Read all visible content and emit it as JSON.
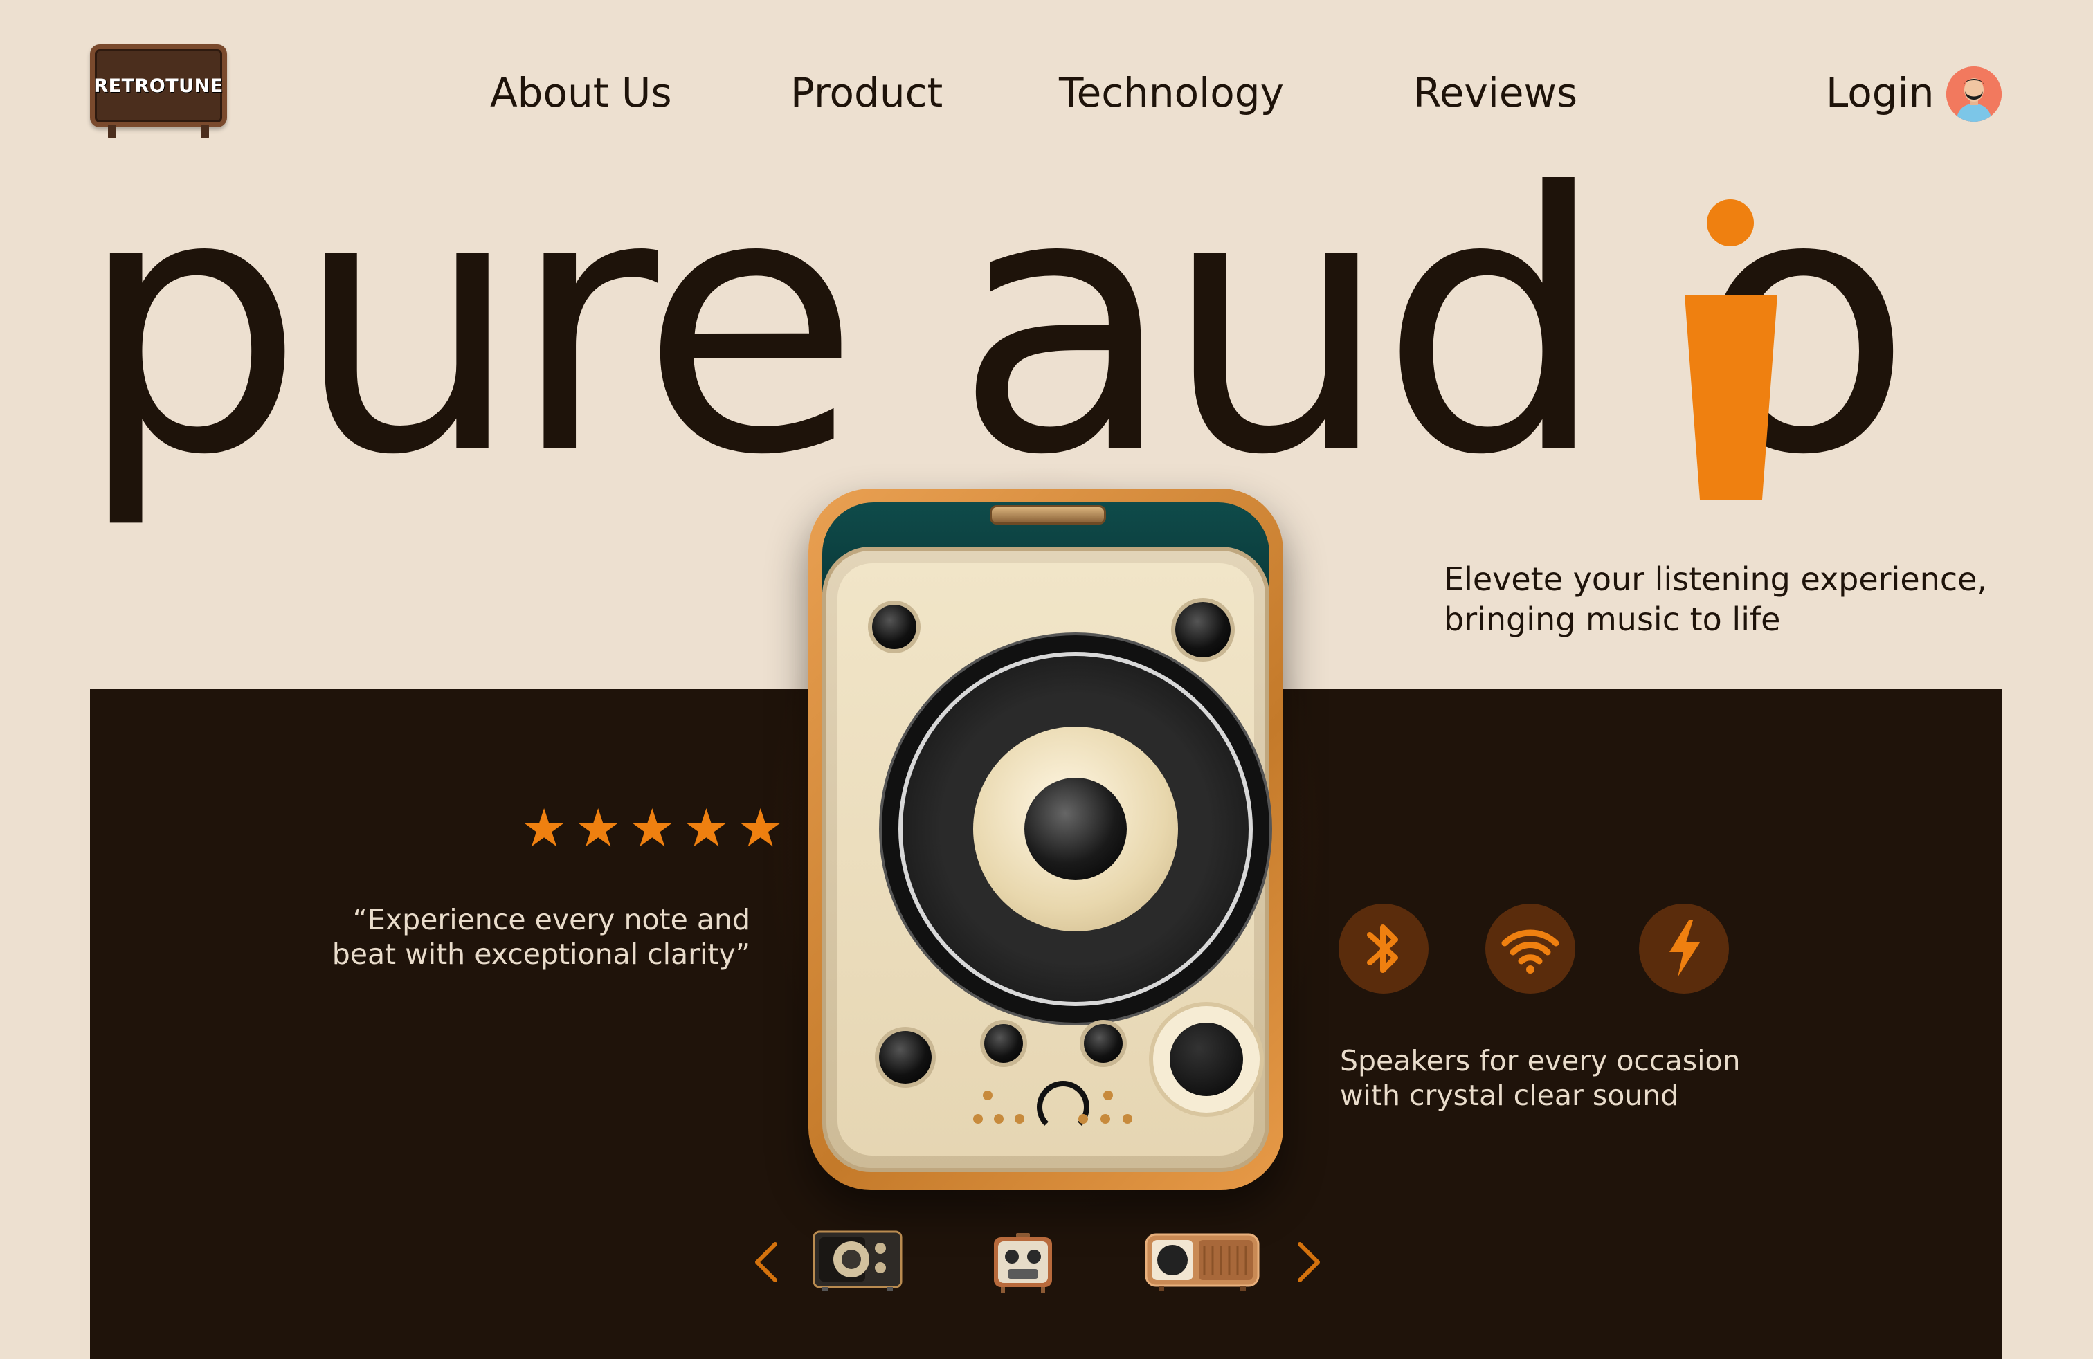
{
  "brand": {
    "logo_text": "RETROTUNE"
  },
  "nav": {
    "items": [
      {
        "label": "About Us"
      },
      {
        "label": "Product"
      },
      {
        "label": "Technology"
      },
      {
        "label": "Reviews"
      }
    ],
    "login_label": "Login"
  },
  "hero": {
    "headline": "pure aud",
    "headline_tail": "o",
    "accent_letter": "i",
    "tagline_lines": [
      "Elevete your listening experience,",
      "bringing music to life"
    ]
  },
  "review": {
    "rating": 5,
    "stars": "★★★★★",
    "quote_lines": [
      "“Experience every note and",
      "beat with exceptional clarity”"
    ]
  },
  "features": {
    "icons": [
      "bluetooth-icon",
      "wifi-icon",
      "lightning-icon"
    ],
    "text_lines": [
      "Speakers for every occasion",
      "with crystal clear sound"
    ]
  },
  "carousel": {
    "prev_icon": "chevron-left-icon",
    "next_icon": "chevron-right-icon",
    "thumbnails": [
      "speaker-thumb-1",
      "speaker-thumb-2",
      "speaker-thumb-3"
    ]
  },
  "colors": {
    "background": "#ede0d0",
    "dark_panel": "#1f130a",
    "accent": "#ef8010",
    "text_dark": "#1e130a",
    "text_light": "#e9dccb"
  }
}
